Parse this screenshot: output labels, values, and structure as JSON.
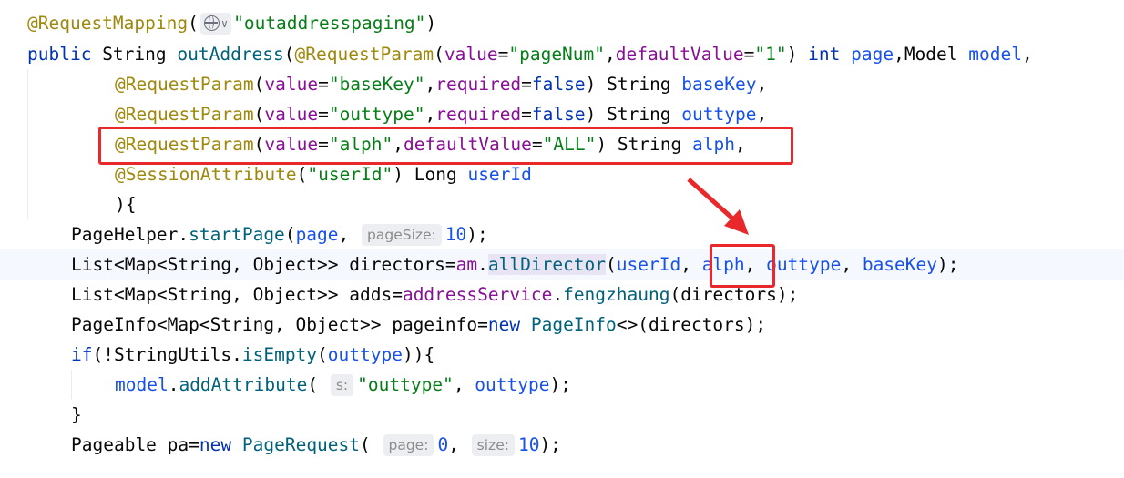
{
  "editor": {
    "lines": [
      {
        "parts": [
          [
            "anno",
            "@RequestMapping"
          ],
          [
            "p",
            "("
          ],
          [
            "icon",
            "globe-icon"
          ],
          [
            "str",
            "\"outaddresspaging\""
          ],
          [
            "p",
            ")"
          ]
        ]
      },
      {
        "parts": [
          [
            "kw",
            "public "
          ],
          [
            "p",
            "String "
          ],
          [
            "fn",
            "outAddress"
          ],
          [
            "p",
            "("
          ],
          [
            "anno",
            "@RequestParam"
          ],
          [
            "p",
            "("
          ],
          [
            "param",
            "value"
          ],
          [
            "p",
            "="
          ],
          [
            "str",
            "\"pageNum\""
          ],
          [
            "p",
            ","
          ],
          [
            "param",
            "defaultValue"
          ],
          [
            "p",
            "="
          ],
          [
            "str",
            "\"1\""
          ],
          [
            "p",
            ") "
          ],
          [
            "kw",
            "int "
          ],
          [
            "var",
            "page"
          ],
          [
            "p",
            ",Model "
          ],
          [
            "var",
            "model"
          ],
          [
            "p",
            ","
          ]
        ]
      },
      {
        "parts": [
          [
            "anno",
            "@RequestParam"
          ],
          [
            "p",
            "("
          ],
          [
            "param",
            "value"
          ],
          [
            "p",
            "="
          ],
          [
            "str",
            "\"baseKey\""
          ],
          [
            "p",
            ","
          ],
          [
            "param",
            "required"
          ],
          [
            "p",
            "="
          ],
          [
            "kw",
            "false"
          ],
          [
            "p",
            ") String "
          ],
          [
            "var",
            "baseKey"
          ],
          [
            "p",
            ","
          ]
        ]
      },
      {
        "parts": [
          [
            "anno",
            "@RequestParam"
          ],
          [
            "p",
            "("
          ],
          [
            "param",
            "value"
          ],
          [
            "p",
            "="
          ],
          [
            "str",
            "\"outtype\""
          ],
          [
            "p",
            ","
          ],
          [
            "param",
            "required"
          ],
          [
            "p",
            "="
          ],
          [
            "kw",
            "false"
          ],
          [
            "p",
            ") String "
          ],
          [
            "var",
            "outtype"
          ],
          [
            "p",
            ","
          ]
        ]
      },
      {
        "parts": [
          [
            "anno",
            "@RequestParam"
          ],
          [
            "p",
            "("
          ],
          [
            "param",
            "value"
          ],
          [
            "p",
            "="
          ],
          [
            "str",
            "\"alph\""
          ],
          [
            "p",
            ","
          ],
          [
            "param",
            "defaultValue"
          ],
          [
            "p",
            "="
          ],
          [
            "str",
            "\"ALL\""
          ],
          [
            "p",
            ") String "
          ],
          [
            "var",
            "alph"
          ],
          [
            "p",
            ","
          ]
        ]
      },
      {
        "parts": [
          [
            "anno",
            "@SessionAttribute"
          ],
          [
            "p",
            "("
          ],
          [
            "str",
            "\"userId\""
          ],
          [
            "p",
            ") Long "
          ],
          [
            "var",
            "userId"
          ]
        ]
      },
      {
        "parts": [
          [
            "p",
            "){"
          ]
        ]
      },
      {
        "parts": [
          [
            "p",
            "PageHelper."
          ],
          [
            "fn",
            "startPage"
          ],
          [
            "p",
            "("
          ],
          [
            "var",
            "page"
          ],
          [
            "p",
            ", "
          ],
          [
            "hint",
            "pageSize:"
          ],
          [
            "var",
            "10"
          ],
          [
            "p",
            ");"
          ]
        ]
      },
      {
        "parts": [
          [
            "p",
            "List<Map<String, Object>> directors="
          ],
          [
            "param",
            "am"
          ],
          [
            "p",
            "."
          ],
          [
            "fnh",
            "allDirector"
          ],
          [
            "p",
            "("
          ],
          [
            "var",
            "userId"
          ],
          [
            "p",
            ", "
          ],
          [
            "var",
            "alph"
          ],
          [
            "p",
            ", "
          ],
          [
            "var",
            "outtype"
          ],
          [
            "p",
            ", "
          ],
          [
            "var",
            "baseKey"
          ],
          [
            "p",
            ");"
          ]
        ]
      },
      {
        "parts": [
          [
            "p",
            "List<Map<String, Object>> adds="
          ],
          [
            "param",
            "addressService"
          ],
          [
            "p",
            "."
          ],
          [
            "fn",
            "fengzhaung"
          ],
          [
            "p",
            "(directors);"
          ]
        ]
      },
      {
        "parts": [
          [
            "p",
            "PageInfo<Map<String, Object>> pageinfo="
          ],
          [
            "kw",
            "new "
          ],
          [
            "fn",
            "PageInfo"
          ],
          [
            "p",
            "<>(directors);"
          ]
        ]
      },
      {
        "parts": [
          [
            "kw",
            "if"
          ],
          [
            "p",
            "(!StringUtils."
          ],
          [
            "fn",
            "isEmpty"
          ],
          [
            "p",
            "("
          ],
          [
            "var",
            "outtype"
          ],
          [
            "p",
            "))"
          ],
          [
            "p",
            "{"
          ]
        ]
      },
      {
        "parts": [
          [
            "var",
            "model"
          ],
          [
            "p",
            "."
          ],
          [
            "fn",
            "addAttribute"
          ],
          [
            "p",
            "( "
          ],
          [
            "hint",
            "s:"
          ],
          [
            "str",
            "\"outtype\""
          ],
          [
            "p",
            ", "
          ],
          [
            "var",
            "outtype"
          ],
          [
            "p",
            ");"
          ]
        ]
      },
      {
        "parts": [
          [
            "p",
            "}"
          ]
        ]
      },
      {
        "parts": [
          [
            "p",
            "Pageable "
          ],
          [
            "p",
            "pa"
          ],
          [
            "p",
            "="
          ],
          [
            "kw",
            "new "
          ],
          [
            "fn",
            "PageRequest"
          ],
          [
            "p",
            "( "
          ],
          [
            "hint",
            "page:"
          ],
          [
            "var",
            "0"
          ],
          [
            "p",
            ", "
          ],
          [
            "hint",
            "size:"
          ],
          [
            "var",
            "10"
          ],
          [
            "p",
            ");"
          ]
        ]
      }
    ],
    "colors": {
      "highlight_box": "#e8282b"
    }
  }
}
